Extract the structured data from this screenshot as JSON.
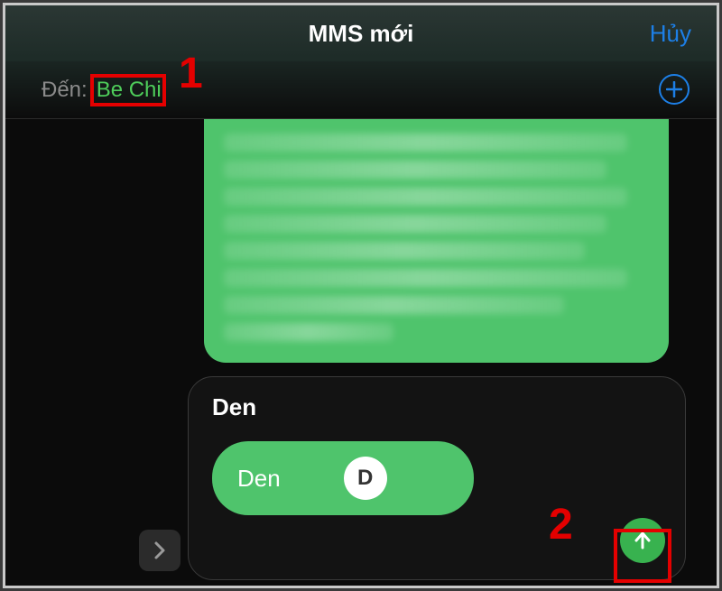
{
  "header": {
    "title": "MMS mới",
    "cancel_label": "Hủy"
  },
  "recipient": {
    "to_label": "Đến:",
    "contact_name": "Be Chi"
  },
  "attachment": {
    "card_title": "Den",
    "pill_label": "Den",
    "avatar_initial": "D"
  },
  "icons": {
    "add": "plus-circle",
    "send": "arrow-up",
    "expand": "chevron-right"
  },
  "annotations": {
    "num1": "1",
    "num2": "2"
  },
  "colors": {
    "accent_green": "#4fc46c",
    "link_blue": "#1d7fe6",
    "callout_red": "#e40000"
  }
}
